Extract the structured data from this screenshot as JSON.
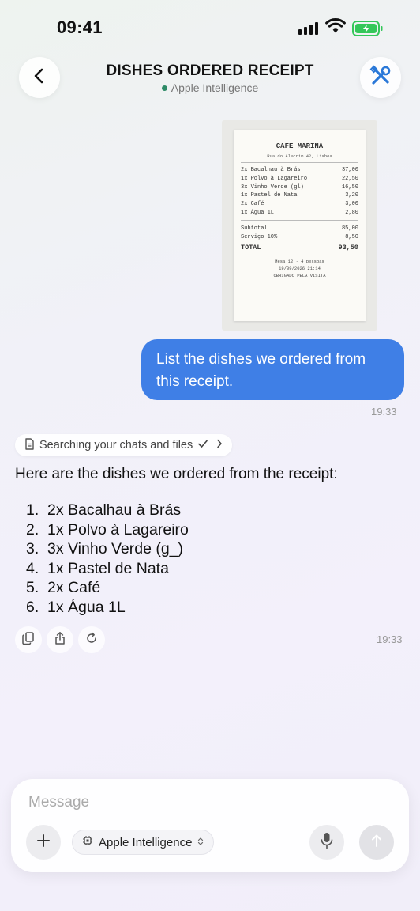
{
  "status_bar": {
    "time": "09:41"
  },
  "header": {
    "title": "DISHES ORDERED RECEIPT",
    "subtitle": "Apple Intelligence"
  },
  "receipt": {
    "name": "CAFE MARINA",
    "address": "Rua do Alecrim 42, Lisboa",
    "items": [
      {
        "name": "2x Bacalhau à Brás",
        "price": "37,00"
      },
      {
        "name": "1x Polvo à Lagareiro",
        "price": "22,50"
      },
      {
        "name": "3x Vinho Verde (gl)",
        "price": "16,50"
      },
      {
        "name": "1x Pastel de Nata",
        "price": "3,20"
      },
      {
        "name": "2x Café",
        "price": "3,00"
      },
      {
        "name": "1x Água 1L",
        "price": "2,80"
      }
    ],
    "subtotal_label": "Subtotal",
    "subtotal": "85,00",
    "service_label": "Serviço 10%",
    "service": "8,50",
    "total_label": "TOTAL",
    "total": "93,50",
    "footer_table": "Mesa 12 · 4 pessoas",
    "footer_date": "19/09/2026  21:14",
    "footer_thanks": "OBRIGADO PELA VISITA"
  },
  "user_message": {
    "text": "List the dishes we ordered from this receipt.",
    "time": "19:33"
  },
  "assistant": {
    "search_chip": "Searching your chats and files",
    "intro": "Here are the dishes we ordered from the receipt:",
    "dishes": [
      {
        "num": "1.",
        "text": "2x Bacalhau à Brás"
      },
      {
        "num": "2.",
        "text": "1x Polvo à Lagareiro"
      },
      {
        "num": "3.",
        "text": "3x Vinho Verde (g_)"
      },
      {
        "num": "4.",
        "text": "1x Pastel de Nata"
      },
      {
        "num": "5.",
        "text": "2x Café"
      },
      {
        "num": "6.",
        "text": "1x Água 1L"
      }
    ],
    "time": "19:33"
  },
  "composer": {
    "placeholder": "Message",
    "model": "Apple Intelligence"
  },
  "colors": {
    "user_bubble": "#3f7fe6",
    "status_dot": "#2e8b67",
    "battery": "#34c759"
  }
}
